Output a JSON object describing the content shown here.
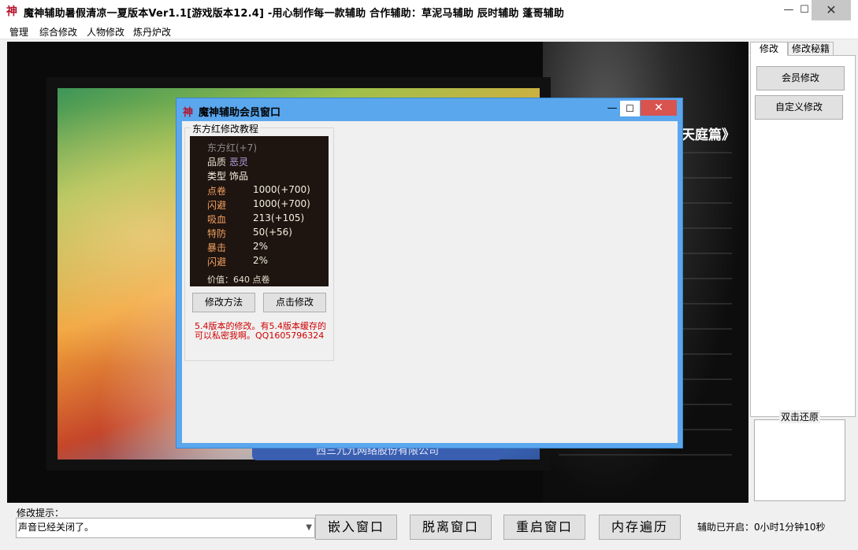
{
  "window": {
    "logo": "神",
    "title": "魔神辅助暑假清凉一夏版本Ver1.1[游戏版本12.4] -用心制作每一款辅助 合作辅助：草泥马辅助 辰时辅助 蓬哥辅助",
    "minimize": "—",
    "maximize": "☐",
    "close": "✕"
  },
  "menu": [
    "管理",
    "综合修改",
    "人物修改",
    "炼丹炉改"
  ],
  "game": {
    "side_text": "天庭篇》",
    "bottom_banner": "西三九九网络股份有限公司"
  },
  "right_panel": {
    "tabs": [
      "修改",
      "修改秘籍"
    ],
    "buttons": [
      "会员修改",
      "自定义修改"
    ],
    "restore_label": "双击还原"
  },
  "dialog": {
    "logo": "神",
    "title": "魔神辅助会员窗口",
    "minimize": "—",
    "maximize": "☐",
    "close": "✕",
    "group_label": "东方红修改教程",
    "item_card": {
      "name": "东方红(+7)",
      "rows": [
        {
          "key": "品质",
          "value": "恶灵"
        },
        {
          "key": "类型",
          "value": "饰品"
        },
        {
          "key": "点卷",
          "value": "1000(+700)"
        },
        {
          "key": "闪避",
          "value": "1000(+700)"
        },
        {
          "key": "吸血",
          "value": "213(+105)"
        },
        {
          "key": "特防",
          "value": "50(+56)"
        },
        {
          "key": "暴击",
          "value": "2%"
        },
        {
          "key": "闪避",
          "value": "2%"
        }
      ],
      "price": "价值：640 点卷"
    },
    "method_button": "修改方法",
    "apply_button": "点击修改",
    "note": "5.4版本的修改。有5.4版本缓存的可以私密我啊。QQ1605796324"
  },
  "bottom": {
    "hint_label": "修改提示：",
    "hint_text": "声音已经关闭了。",
    "buttons": [
      "嵌入窗口",
      "脱离窗口",
      "重启窗口",
      "内存遍历"
    ],
    "elapsed": "辅助已开启：0小时1分钟10秒"
  },
  "colors": {
    "dialog_frame": "#5aa7ee",
    "close_button": "#d9534f",
    "note_text": "#d00000",
    "logo": "#b5122b"
  }
}
